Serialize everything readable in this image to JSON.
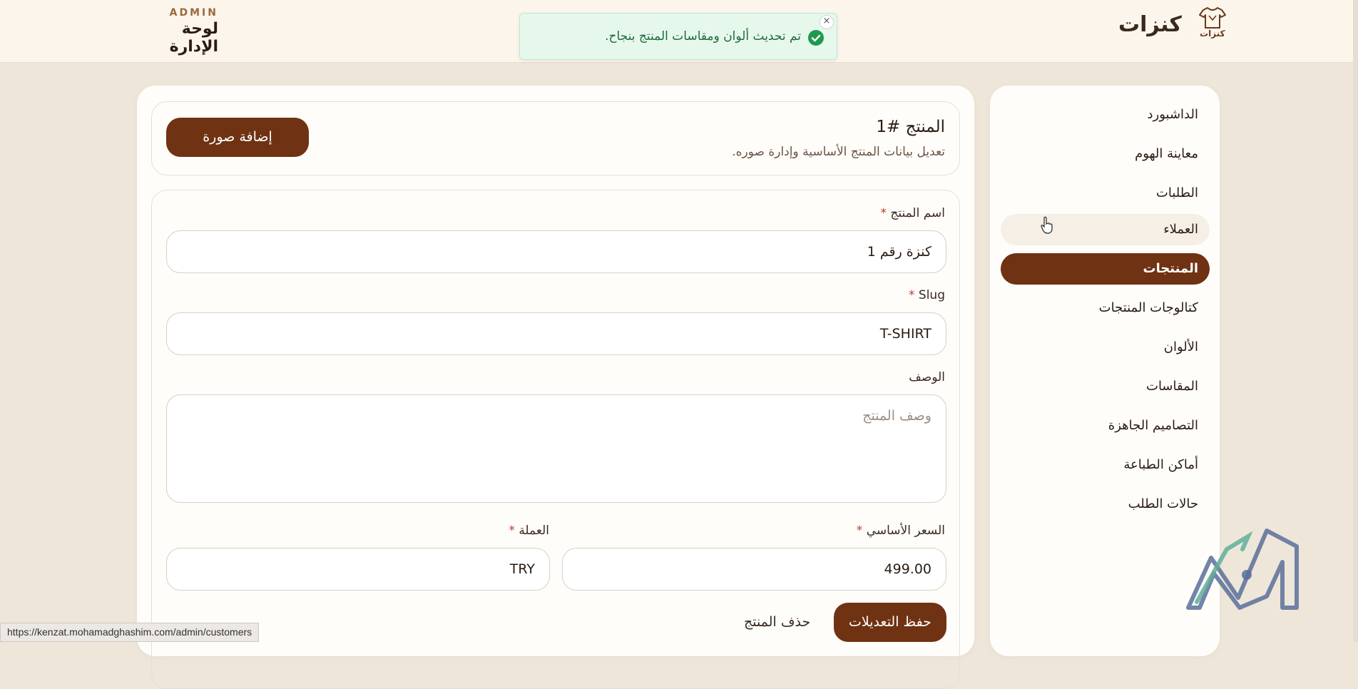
{
  "header": {
    "admin_label": "ADMIN",
    "admin_title": "لوحة الإدارة",
    "brand_name": "كنزات",
    "brand_logo_text": "كنزات"
  },
  "toast": {
    "message": "تم تحديث ألوان ومقاسات المنتج بنجاح.",
    "close_label": "×"
  },
  "sidebar": {
    "items": [
      {
        "label": "الداشبورد",
        "state": "normal"
      },
      {
        "label": "معاينة الهوم",
        "state": "normal"
      },
      {
        "label": "الطلبات",
        "state": "normal"
      },
      {
        "label": "العملاء",
        "state": "hover"
      },
      {
        "label": "المنتجات",
        "state": "active"
      },
      {
        "label": "كتالوجات المنتجات",
        "state": "normal"
      },
      {
        "label": "الألوان",
        "state": "normal"
      },
      {
        "label": "المقاسات",
        "state": "normal"
      },
      {
        "label": "التصاميم الجاهزة",
        "state": "normal"
      },
      {
        "label": "أماكن الطباعة",
        "state": "normal"
      },
      {
        "label": "حالات الطلب",
        "state": "normal"
      }
    ]
  },
  "product": {
    "title": "المنتج #1",
    "subtitle": "تعديل بيانات المنتج الأساسية وإدارة صوره.",
    "add_image_label": "إضافة صورة"
  },
  "form": {
    "name_label": "اسم المنتج",
    "name_value": "كنزة رقم 1",
    "slug_label": "Slug",
    "slug_value": "T-SHIRT",
    "description_label": "الوصف",
    "description_placeholder": "وصف المنتج",
    "price_label": "السعر الأساسي",
    "price_value": "499.00",
    "currency_label": "العملة",
    "currency_value": "TRY",
    "required_mark": "*",
    "save_label": "حفظ التعديلات",
    "delete_label": "حذف المنتج"
  },
  "status_bar": {
    "url": "https://kenzat.mohamadghashim.com/admin/customers"
  },
  "colors": {
    "primary": "#6f3213",
    "page_bg": "#efe6da",
    "topbar_bg": "#fbf5ec",
    "toast_bg": "#e6f7ec",
    "toast_text": "#1f6b3a"
  }
}
